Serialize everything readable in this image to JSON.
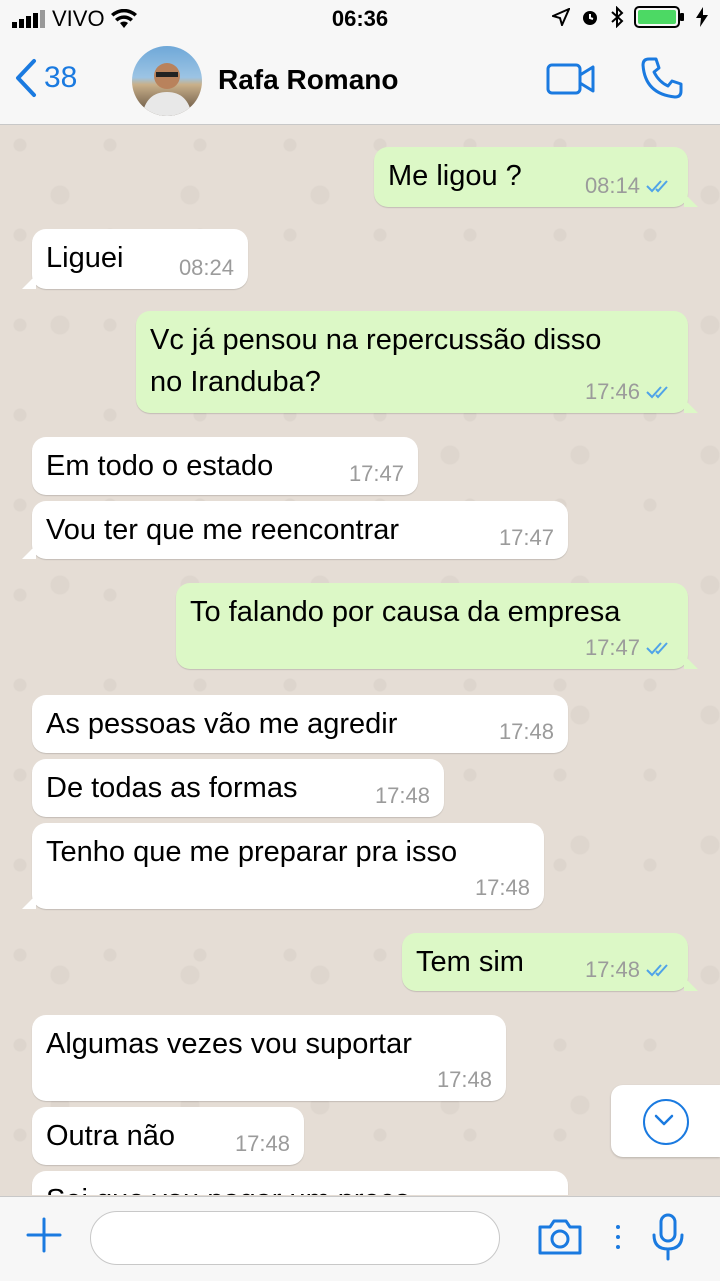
{
  "status_bar": {
    "carrier": "VIVO",
    "time": "06:36"
  },
  "header": {
    "back_count": "38",
    "contact_name": "Rafa Romano"
  },
  "messages": [
    {
      "dir": "out",
      "text": "Me ligou ?",
      "time": "08:14",
      "read": true
    },
    {
      "dir": "in",
      "text": "Liguei",
      "time": "08:24"
    },
    {
      "dir": "out",
      "text": "Vc já pensou na repercussão disso\nno Iranduba?",
      "time": "17:46",
      "read": true
    },
    {
      "dir": "in",
      "text": "Em todo o estado",
      "time": "17:47"
    },
    {
      "dir": "in",
      "text": "Vou ter que me reencontrar",
      "time": "17:47"
    },
    {
      "dir": "out",
      "text": "To falando por causa da empresa",
      "time": "17:47",
      "read": true
    },
    {
      "dir": "in",
      "text": "As pessoas vão me agredir",
      "time": "17:48"
    },
    {
      "dir": "in",
      "text": "De todas as formas",
      "time": "17:48"
    },
    {
      "dir": "in",
      "text": "Tenho que me preparar pra isso",
      "time": "17:48"
    },
    {
      "dir": "out",
      "text": "Tem sim",
      "time": "17:48",
      "read": true
    },
    {
      "dir": "in",
      "text": "Algumas vezes vou suportar",
      "time": "17:48"
    },
    {
      "dir": "in",
      "text": "Outra não",
      "time": "17:48"
    },
    {
      "dir": "in",
      "text": "Sei que vou pagar um preço",
      "time": ""
    }
  ],
  "input": {
    "placeholder": ""
  },
  "colors": {
    "accent": "#1a7ae0",
    "outgoing_bubble": "#dcf8c6",
    "incoming_bubble": "#ffffff",
    "chat_bg": "#e5ddd5",
    "read_ticks": "#4fa3e8"
  }
}
